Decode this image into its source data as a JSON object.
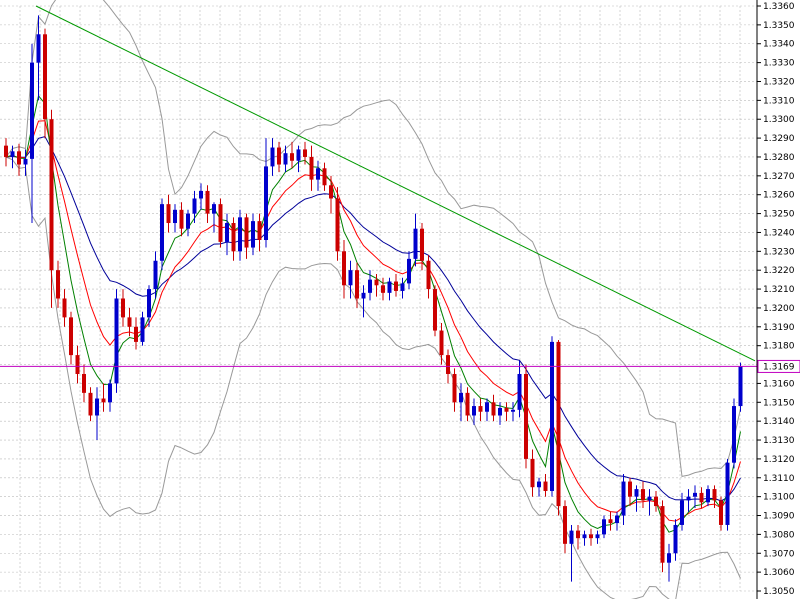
{
  "chart_data": {
    "type": "candlestick",
    "y_axis": {
      "min": 1.305,
      "max": 1.336,
      "tick_labels": [
        "1.3360",
        "1.3350",
        "1.3340",
        "1.3330",
        "1.3320",
        "1.3310",
        "1.3300",
        "1.3290",
        "1.3280",
        "1.3270",
        "1.3260",
        "1.3250",
        "1.3240",
        "1.3230",
        "1.3220",
        "1.3210",
        "1.3200",
        "1.3190",
        "1.3180",
        "1.3170",
        "1.3160",
        "1.3150",
        "1.3140",
        "1.3130",
        "1.3120",
        "1.3110",
        "1.3100",
        "1.3090",
        "1.3080",
        "1.3070",
        "1.3060",
        "1.3050"
      ],
      "position": "right"
    },
    "grid": true,
    "current_price": {
      "value": 1.3169,
      "label": "1.3169",
      "color": "#c000c0"
    },
    "colors": {
      "bull_candle": "#0000cc",
      "bear_candle": "#cc0000",
      "trendline": "#009900",
      "ma_fast": "#008000",
      "ma_mid": "#ff0000",
      "ma_slow": "#000099",
      "bollinger": "#999999",
      "grid": "#bbbbbb"
    },
    "trendline": {
      "start": [
        0,
        1.336
      ],
      "end": [
        114,
        1.3172
      ]
    },
    "candles": [
      [
        1.3286,
        1.329,
        1.3275,
        1.328
      ],
      [
        1.328,
        1.3286,
        1.3274,
        1.3283
      ],
      [
        1.3283,
        1.3287,
        1.327,
        1.3276
      ],
      [
        1.3276,
        1.3284,
        1.327,
        1.3279
      ],
      [
        1.3279,
        1.334,
        1.3245,
        1.333
      ],
      [
        1.333,
        1.3355,
        1.331,
        1.3345
      ],
      [
        1.3345,
        1.3348,
        1.329,
        1.33
      ],
      [
        1.33,
        1.3305,
        1.32,
        1.322
      ],
      [
        1.322,
        1.3225,
        1.32,
        1.3205
      ],
      [
        1.3205,
        1.321,
        1.319,
        1.3195
      ],
      [
        1.3195,
        1.3198,
        1.317,
        1.3175
      ],
      [
        1.3175,
        1.318,
        1.316,
        1.3165
      ],
      [
        1.3165,
        1.317,
        1.315,
        1.3155
      ],
      [
        1.3155,
        1.3158,
        1.314,
        1.3143
      ],
      [
        1.3143,
        1.3158,
        1.313,
        1.3152
      ],
      [
        1.3152,
        1.316,
        1.3145,
        1.315
      ],
      [
        1.315,
        1.3162,
        1.3145,
        1.316
      ],
      [
        1.316,
        1.321,
        1.3155,
        1.3205
      ],
      [
        1.3205,
        1.321,
        1.319,
        1.3195
      ],
      [
        1.3195,
        1.32,
        1.3185,
        1.319
      ],
      [
        1.319,
        1.3195,
        1.3178,
        1.3182
      ],
      [
        1.3182,
        1.3198,
        1.318,
        1.3195
      ],
      [
        1.3195,
        1.3212,
        1.319,
        1.321
      ],
      [
        1.321,
        1.323,
        1.3205,
        1.3225
      ],
      [
        1.3225,
        1.3258,
        1.322,
        1.3255
      ],
      [
        1.3255,
        1.326,
        1.324,
        1.3245
      ],
      [
        1.3245,
        1.3255,
        1.324,
        1.3252
      ],
      [
        1.3252,
        1.3256,
        1.3238,
        1.3242
      ],
      [
        1.3242,
        1.3252,
        1.3238,
        1.325
      ],
      [
        1.325,
        1.3262,
        1.3245,
        1.3258
      ],
      [
        1.3258,
        1.3266,
        1.3252,
        1.3262
      ],
      [
        1.3262,
        1.3265,
        1.3245,
        1.325
      ],
      [
        1.325,
        1.3256,
        1.324,
        1.3255
      ],
      [
        1.3255,
        1.3258,
        1.3232,
        1.3235
      ],
      [
        1.3235,
        1.325,
        1.3228,
        1.3245
      ],
      [
        1.3245,
        1.3248,
        1.3225,
        1.323
      ],
      [
        1.323,
        1.3252,
        1.3225,
        1.3248
      ],
      [
        1.3248,
        1.325,
        1.3226,
        1.3232
      ],
      [
        1.3232,
        1.325,
        1.3228,
        1.3246
      ],
      [
        1.3246,
        1.325,
        1.323,
        1.3236
      ],
      [
        1.3236,
        1.329,
        1.3232,
        1.3275
      ],
      [
        1.3275,
        1.329,
        1.327,
        1.3285
      ],
      [
        1.3285,
        1.3288,
        1.3272,
        1.3276
      ],
      [
        1.3276,
        1.3286,
        1.3272,
        1.3282
      ],
      [
        1.3282,
        1.3288,
        1.3274,
        1.3278
      ],
      [
        1.3278,
        1.3286,
        1.3272,
        1.3284
      ],
      [
        1.3284,
        1.3288,
        1.3276,
        1.328
      ],
      [
        1.328,
        1.3286,
        1.3262,
        1.3268
      ],
      [
        1.3268,
        1.3278,
        1.3262,
        1.3274
      ],
      [
        1.3274,
        1.3277,
        1.3262,
        1.3265
      ],
      [
        1.3265,
        1.327,
        1.325,
        1.3258
      ],
      [
        1.3258,
        1.3264,
        1.3225,
        1.323
      ],
      [
        1.323,
        1.3236,
        1.3205,
        1.3212
      ],
      [
        1.3212,
        1.3225,
        1.3205,
        1.322
      ],
      [
        1.322,
        1.3224,
        1.32,
        1.3205
      ],
      [
        1.3205,
        1.3212,
        1.3195,
        1.3208
      ],
      [
        1.3208,
        1.322,
        1.3204,
        1.3215
      ],
      [
        1.3215,
        1.3218,
        1.3206,
        1.3212
      ],
      [
        1.3212,
        1.3216,
        1.3204,
        1.3208
      ],
      [
        1.3208,
        1.3216,
        1.3204,
        1.3214
      ],
      [
        1.3214,
        1.3218,
        1.3206,
        1.3209
      ],
      [
        1.3209,
        1.3216,
        1.3205,
        1.3213
      ],
      [
        1.3213,
        1.323,
        1.321,
        1.3226
      ],
      [
        1.3226,
        1.325,
        1.3222,
        1.3242
      ],
      [
        1.3242,
        1.3245,
        1.322,
        1.3225
      ],
      [
        1.3225,
        1.3228,
        1.3205,
        1.321
      ],
      [
        1.321,
        1.3212,
        1.3185,
        1.3188
      ],
      [
        1.3188,
        1.3192,
        1.317,
        1.3175
      ],
      [
        1.3175,
        1.3178,
        1.316,
        1.3165
      ],
      [
        1.3165,
        1.3168,
        1.3145,
        1.315
      ],
      [
        1.315,
        1.316,
        1.314,
        1.3155
      ],
      [
        1.3155,
        1.3158,
        1.314,
        1.3143
      ],
      [
        1.3143,
        1.3152,
        1.3138,
        1.3148
      ],
      [
        1.3148,
        1.3152,
        1.314,
        1.3145
      ],
      [
        1.3145,
        1.3152,
        1.314,
        1.315
      ],
      [
        1.315,
        1.3154,
        1.314,
        1.3143
      ],
      [
        1.3143,
        1.315,
        1.3138,
        1.3147
      ],
      [
        1.3147,
        1.315,
        1.314,
        1.3145
      ],
      [
        1.3145,
        1.315,
        1.314,
        1.3146
      ],
      [
        1.3146,
        1.3172,
        1.3142,
        1.3165
      ],
      [
        1.3165,
        1.317,
        1.3115,
        1.312
      ],
      [
        1.312,
        1.3125,
        1.31,
        1.3105
      ],
      [
        1.3105,
        1.311,
        1.31,
        1.3108
      ],
      [
        1.3108,
        1.3112,
        1.31,
        1.3103
      ],
      [
        1.3103,
        1.3185,
        1.31,
        1.3182
      ],
      [
        1.3182,
        1.3183,
        1.309,
        1.3095
      ],
      [
        1.3095,
        1.3098,
        1.307,
        1.3075
      ],
      [
        1.3075,
        1.3085,
        1.3055,
        1.3082
      ],
      [
        1.3082,
        1.3085,
        1.3072,
        1.3078
      ],
      [
        1.3078,
        1.3082,
        1.3074,
        1.308
      ],
      [
        1.308,
        1.3083,
        1.3074,
        1.3078
      ],
      [
        1.3078,
        1.3082,
        1.3075,
        1.308
      ],
      [
        1.308,
        1.309,
        1.3078,
        1.3088
      ],
      [
        1.3088,
        1.3092,
        1.3082,
        1.3086
      ],
      [
        1.3086,
        1.3092,
        1.3082,
        1.309
      ],
      [
        1.309,
        1.3112,
        1.3085,
        1.3108
      ],
      [
        1.3108,
        1.311,
        1.3095,
        1.31
      ],
      [
        1.31,
        1.3106,
        1.3092,
        1.3104
      ],
      [
        1.3104,
        1.3108,
        1.3094,
        1.3098
      ],
      [
        1.3098,
        1.3104,
        1.309,
        1.31
      ],
      [
        1.31,
        1.3103,
        1.3092,
        1.3095
      ],
      [
        1.3095,
        1.3098,
        1.306,
        1.3065
      ],
      [
        1.3065,
        1.3075,
        1.3055,
        1.307
      ],
      [
        1.307,
        1.3088,
        1.3066,
        1.3085
      ],
      [
        1.3085,
        1.3102,
        1.3082,
        1.3098
      ],
      [
        1.3098,
        1.3104,
        1.3092,
        1.31
      ],
      [
        1.31,
        1.3106,
        1.3094,
        1.3102
      ],
      [
        1.3102,
        1.3105,
        1.3094,
        1.3097
      ],
      [
        1.3097,
        1.3106,
        1.3095,
        1.3104
      ],
      [
        1.3104,
        1.3106,
        1.3094,
        1.3098
      ],
      [
        1.3098,
        1.31,
        1.3082,
        1.3085
      ],
      [
        1.3085,
        1.312,
        1.3082,
        1.3118
      ],
      [
        1.3118,
        1.3152,
        1.3115,
        1.3148
      ],
      [
        1.3148,
        1.3171,
        1.3145,
        1.3169
      ]
    ]
  }
}
